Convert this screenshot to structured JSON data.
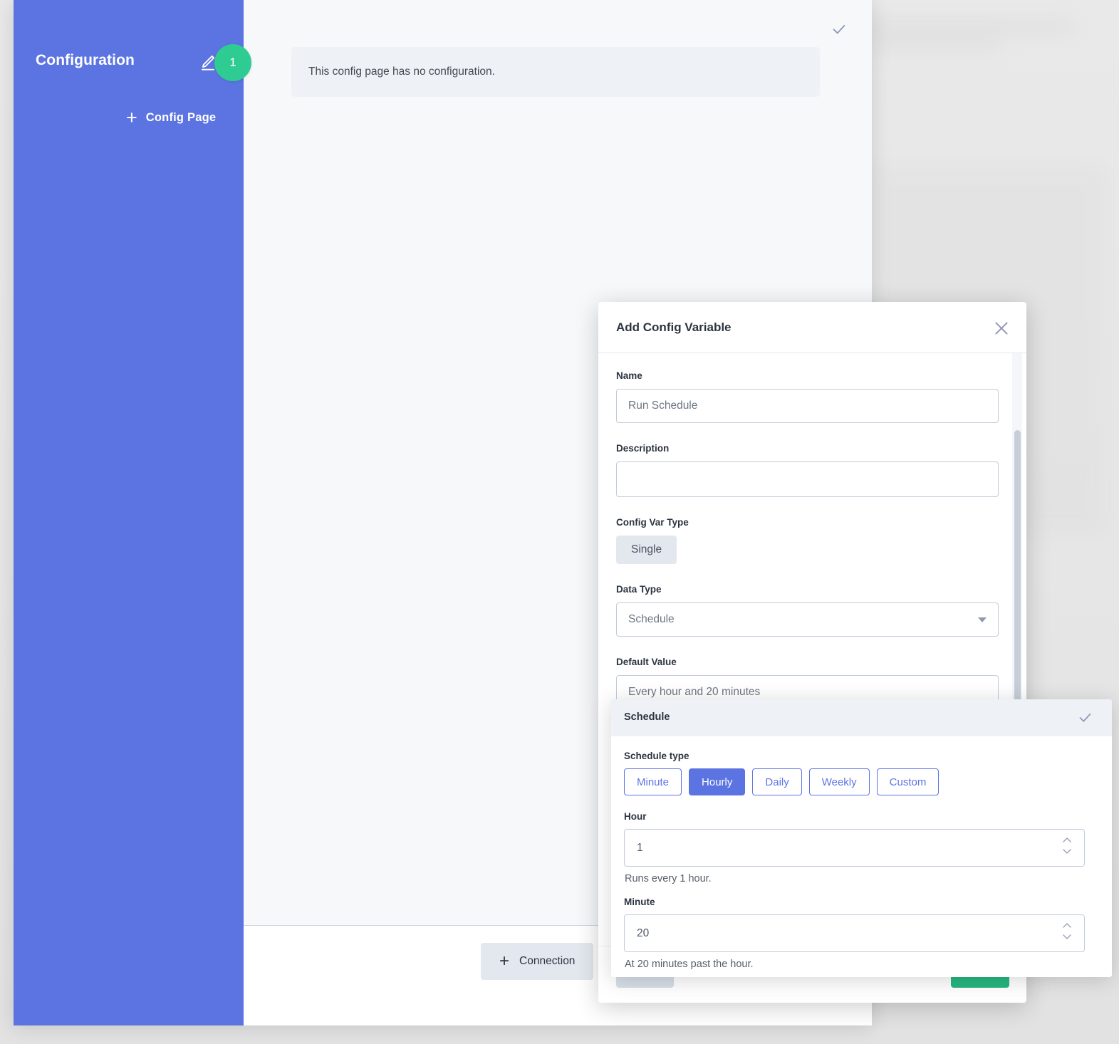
{
  "sidebar": {
    "title": "Configuration",
    "edit_icon": "pencil-icon",
    "badge_count": "1",
    "add_config_page_label": "Config Page",
    "plus": "+",
    "background_color": "#5c74e2"
  },
  "main": {
    "empty_message": "This config page has no configuration.",
    "check_icon": "check-icon"
  },
  "app_footer": {
    "add_connection_label": "Connection",
    "plus": "+"
  },
  "modal": {
    "title": "Add Config Variable",
    "close_icon": "close-icon",
    "fields": {
      "name": {
        "label": "Name",
        "value": "Run Schedule",
        "placeholder": "Name"
      },
      "description": {
        "label": "Description",
        "value": "",
        "placeholder": ""
      },
      "config_var_type": {
        "label": "Config Var Type",
        "selected": "Single"
      },
      "data_type": {
        "label": "Data Type",
        "selected": "Schedule",
        "caret": "chevron-down-icon"
      },
      "default_value": {
        "label": "Default Value",
        "value": "Every hour and 20 minutes",
        "placeholder": "Default Value"
      }
    },
    "footer": {
      "cancel_label": "",
      "save_label": "",
      "cancel_color": "#d7dee6",
      "save_color": "#26b77f"
    }
  },
  "schedule_panel": {
    "title": "Schedule",
    "confirm_icon": "check-icon",
    "schedule_type": {
      "label": "Schedule type",
      "options": [
        "Minute",
        "Hourly",
        "Daily",
        "Weekly",
        "Custom"
      ],
      "selected": "Hourly"
    },
    "hour": {
      "label": "Hour",
      "value": "1",
      "hint": "Runs every 1 hour."
    },
    "minute": {
      "label": "Minute",
      "value": "20",
      "hint": "At 20 minutes past the hour."
    },
    "accent_color": "#5c74e2"
  }
}
